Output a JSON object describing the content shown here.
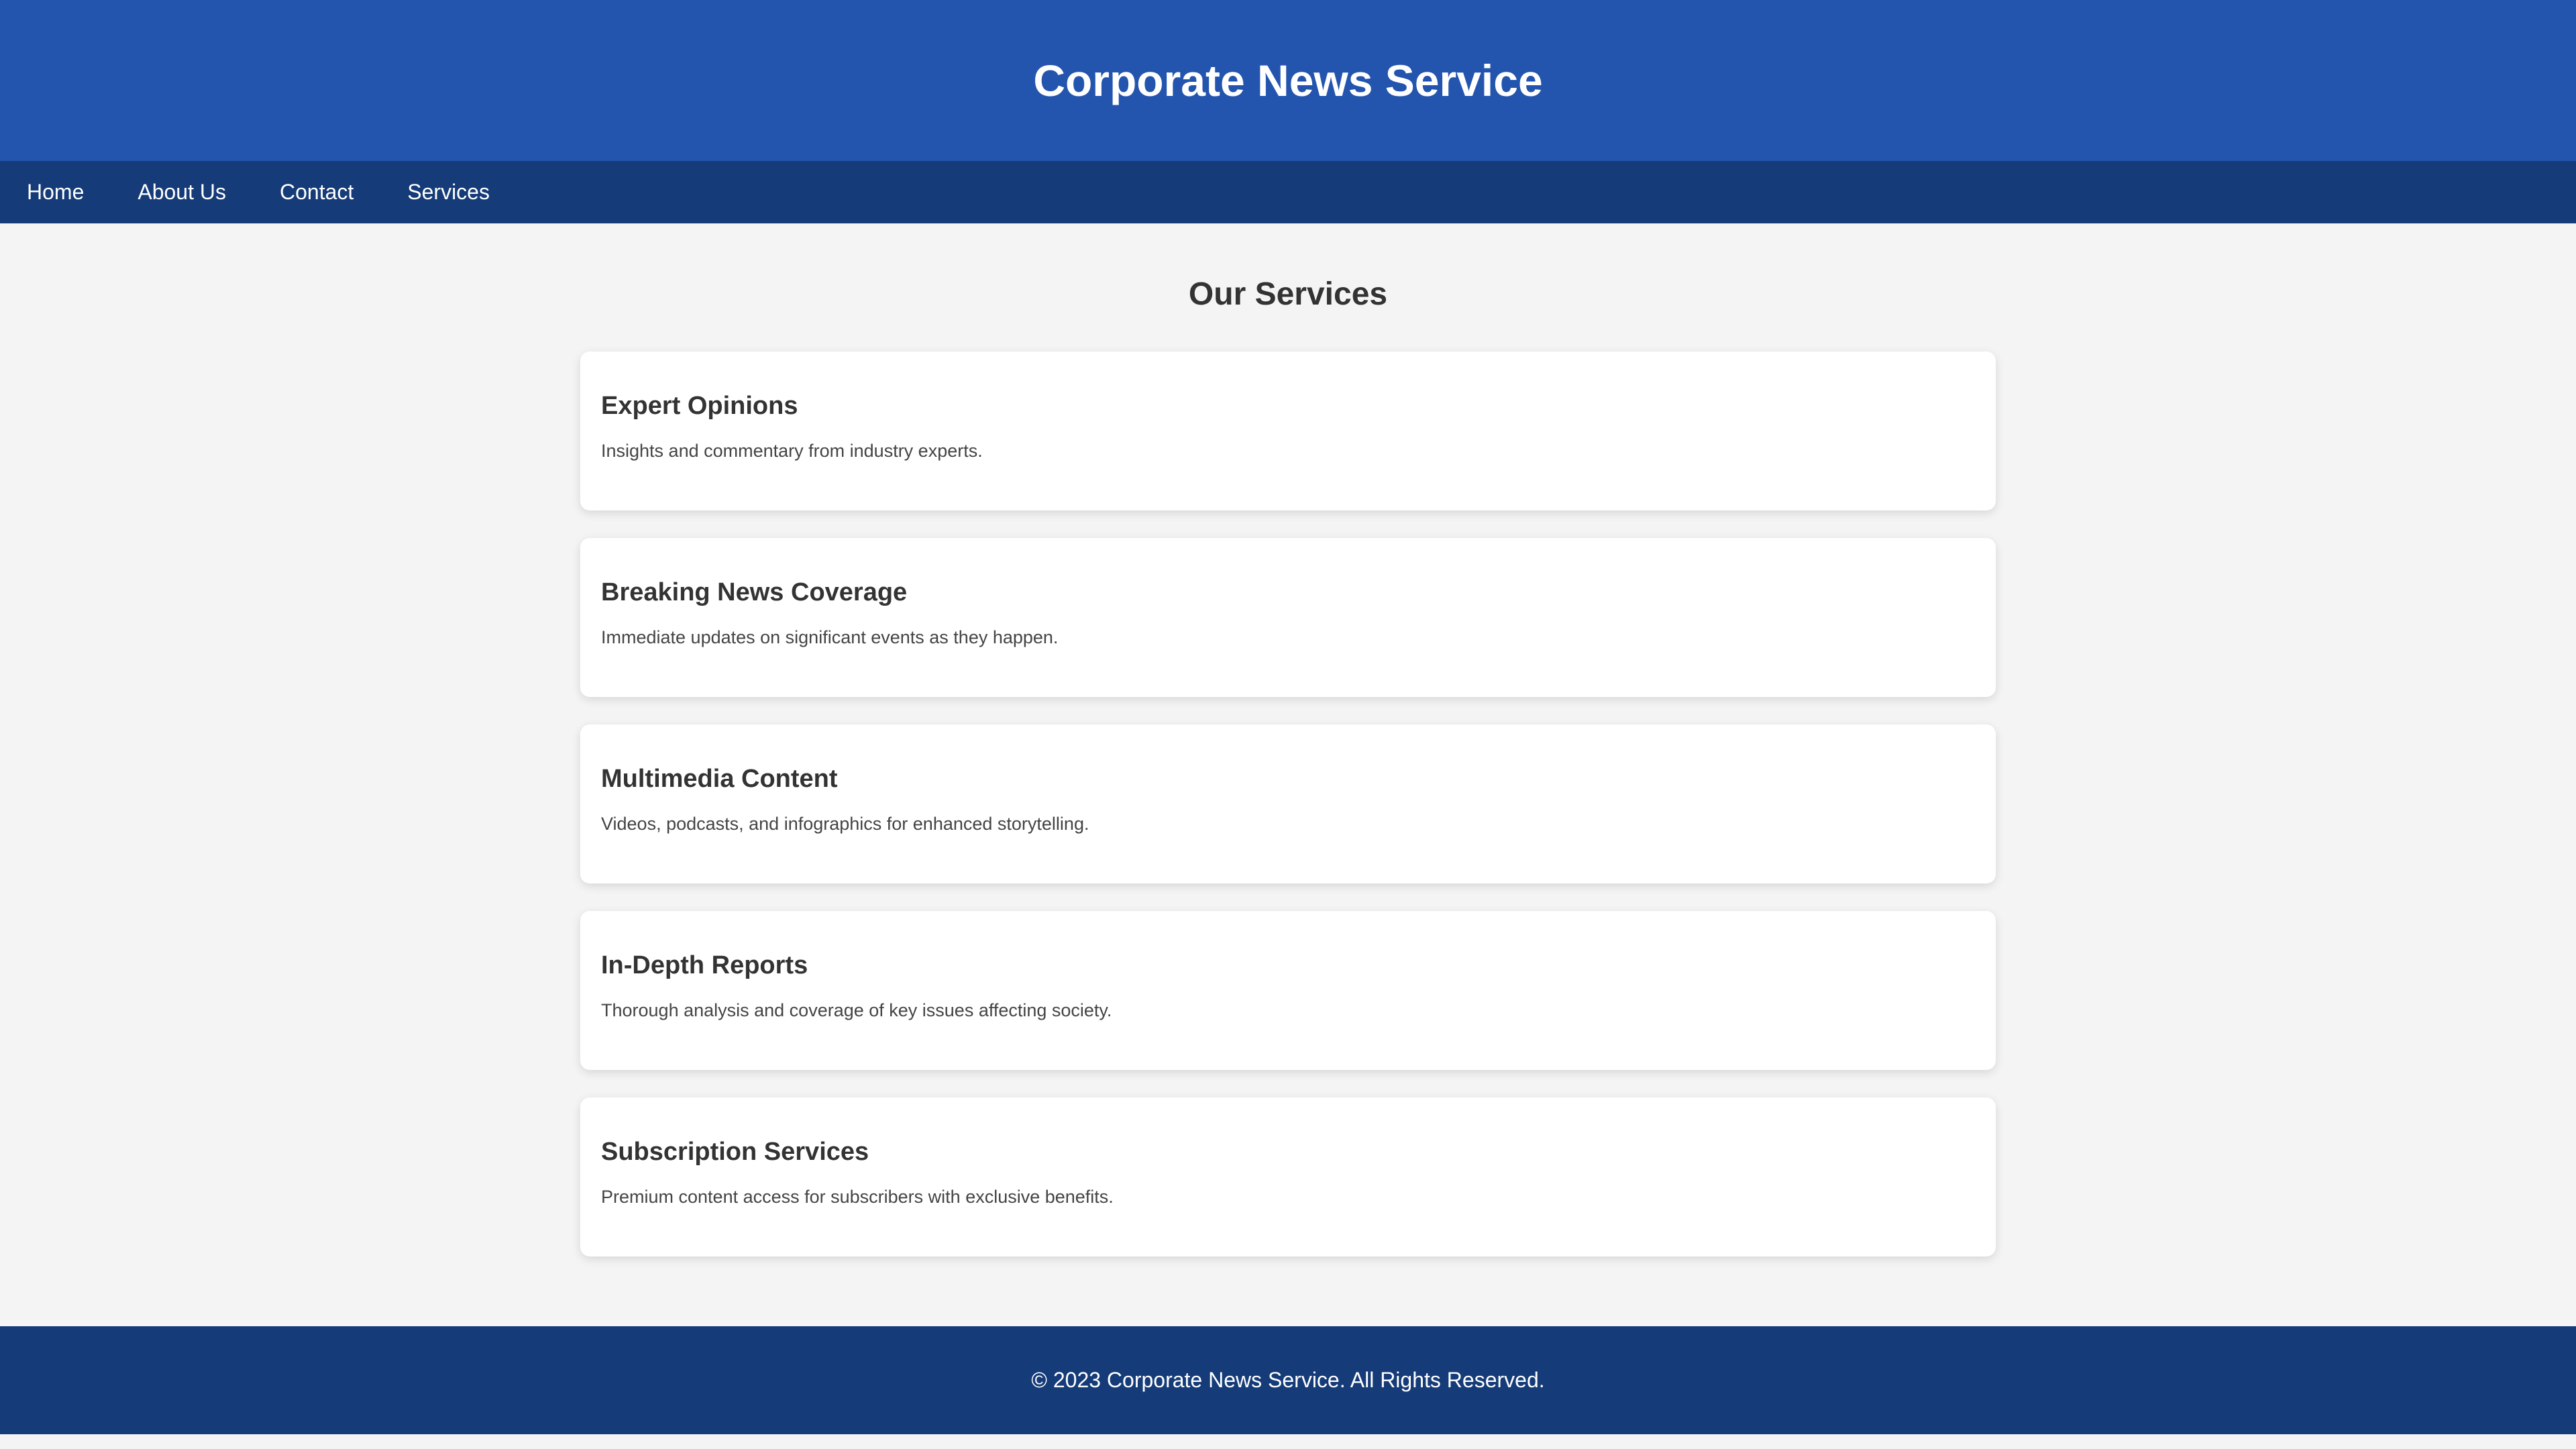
{
  "header": {
    "title": "Corporate News Service"
  },
  "nav": {
    "items": [
      "Home",
      "About Us",
      "Contact",
      "Services"
    ]
  },
  "main": {
    "section_title": "Our Services",
    "services": [
      {
        "title": "Expert Opinions",
        "description": "Insights and commentary from industry experts."
      },
      {
        "title": "Breaking News Coverage",
        "description": "Immediate updates on significant events as they happen."
      },
      {
        "title": "Multimedia Content",
        "description": "Videos, podcasts, and infographics for enhanced storytelling."
      },
      {
        "title": "In-Depth Reports",
        "description": "Thorough analysis and coverage of key issues affecting society."
      },
      {
        "title": "Subscription Services",
        "description": "Premium content access for subscribers with exclusive benefits."
      }
    ]
  },
  "footer": {
    "text": "© 2023 Corporate News Service. All Rights Reserved."
  },
  "colors": {
    "header_bg": "#2455ae",
    "nav_bg": "#153b78",
    "page_bg": "#f4f4f4",
    "card_bg": "#ffffff"
  }
}
